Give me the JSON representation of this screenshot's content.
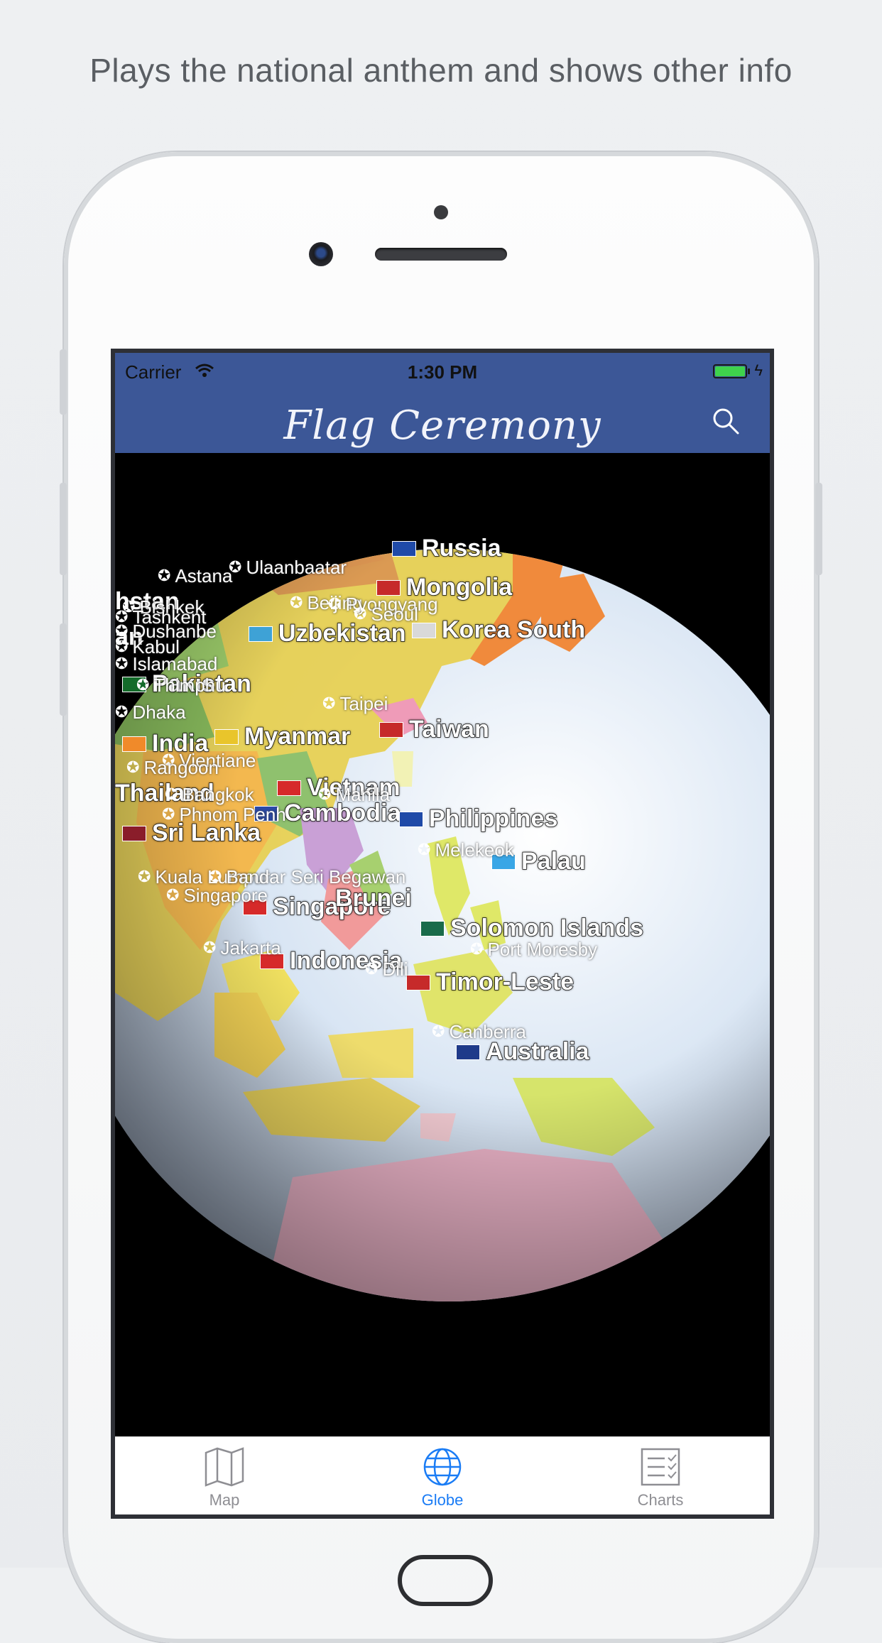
{
  "caption": "Plays the national anthem and shows other info",
  "status_bar": {
    "carrier": "Carrier",
    "time": "1:30 PM"
  },
  "nav": {
    "title_logo": "Flag Ceremony",
    "search_icon": "search-icon"
  },
  "globe": {
    "countries": [
      "Russia",
      "Mongolia",
      "Uzbekistan",
      "Pakistan",
      "India",
      "Myanmar",
      "Korea South",
      "Taiwan",
      "Vietnam",
      "Cambodia",
      "Thailand",
      "Sri Lanka",
      "Philippines",
      "Palau",
      "Singapore",
      "Brunei",
      "Solomon Islands",
      "Indonesia",
      "Timor-Leste",
      "Australia",
      "hstan",
      "an"
    ],
    "capitals": [
      "Astana",
      "Ulaanbaatar",
      "Beijing",
      "Pyongyang",
      "Seoul",
      "Bishkek",
      "Tashkent",
      "Dushanbe",
      "Kabul",
      "Islamabad",
      "Thimphu",
      "Dhaka",
      "Taipei",
      "Vientiane",
      "Rangoon",
      "Bangkok",
      "Manila",
      "Phnom Penh",
      "Melekeok",
      "Kuala Lumpur",
      "Bandar Seri Begawan",
      "Singapore",
      "Jakarta",
      "Port Moresby",
      "Dili",
      "Canberra"
    ]
  },
  "tabs": [
    {
      "label": "Map",
      "icon": "map-icon",
      "active": false
    },
    {
      "label": "Globe",
      "icon": "globe-icon",
      "active": true
    },
    {
      "label": "Charts",
      "icon": "charts-icon",
      "active": false
    }
  ],
  "colors": {
    "navbar": "#3c5797",
    "accent": "#1a7cf5",
    "battery": "#3fd24c"
  }
}
